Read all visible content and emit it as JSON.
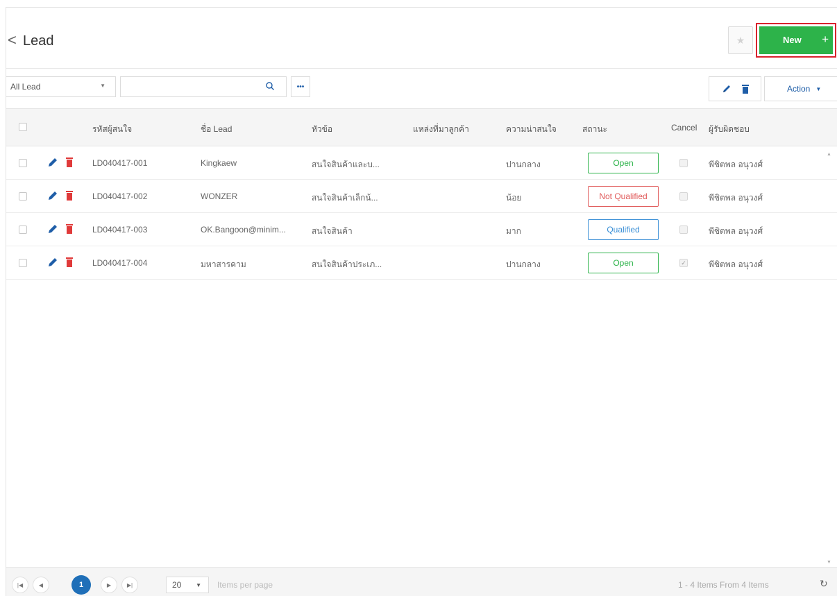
{
  "header": {
    "back_glyph": "<",
    "title": "Lead",
    "new_label": "New",
    "new_plus": "+"
  },
  "toolbar": {
    "filter_value": "All Lead",
    "search_value": "",
    "more_glyph": "•••",
    "action_label": "Action"
  },
  "grid": {
    "columns": {
      "code": "รหัสผู้สนใจ",
      "name": "ชื่อ Lead",
      "subject": "หัวข้อ",
      "source": "แหล่งที่มาลูกค้า",
      "interest": "ความน่าสนใจ",
      "status": "สถานะ",
      "cancel": "Cancel",
      "owner": "ผู้รับผิดชอบ"
    },
    "rows": [
      {
        "code": "LD040417-001",
        "name": "Kingkaew",
        "subject": "สนใจสินค้าและบ...",
        "source": "",
        "interest": "ปานกลาง",
        "status": "Open",
        "cancel": false,
        "owner": "พีชิตพล อนุวงศ์"
      },
      {
        "code": "LD040417-002",
        "name": "WONZER",
        "subject": "สนใจสินค้าเล็กน้...",
        "source": "",
        "interest": "น้อย",
        "status": "Not Qualified",
        "cancel": false,
        "owner": "พีชิตพล อนุวงศ์"
      },
      {
        "code": "LD040417-003",
        "name": "OK.Bangoon@minim...",
        "subject": "สนใจสินค้า",
        "source": "",
        "interest": "มาก",
        "status": "Qualified",
        "cancel": false,
        "owner": "พีชิตพล อนุวงศ์"
      },
      {
        "code": "LD040417-004",
        "name": "มหาสารคาม",
        "subject": "สนใจสินค้าประเภ...",
        "source": "",
        "interest": "ปานกลาง",
        "status": "Open",
        "cancel": true,
        "owner": "พีชิตพล อนุวงศ์"
      }
    ]
  },
  "pager": {
    "current_page": "1",
    "page_size": "20",
    "page_size_label": "Items per page",
    "info": "1 - 4 Items From 4 Items"
  },
  "colors": {
    "new_button": "#2db34a",
    "highlight_border": "#d9232d",
    "accent_blue": "#1f6fb8",
    "status_open": "#2db34a",
    "status_not_qualified": "#e05a5a",
    "status_qualified": "#3a8fd6"
  },
  "icons": {
    "star": "star-icon",
    "search": "search-icon",
    "edit": "pencil-icon",
    "delete": "trash-icon",
    "refresh": "refresh-icon"
  }
}
